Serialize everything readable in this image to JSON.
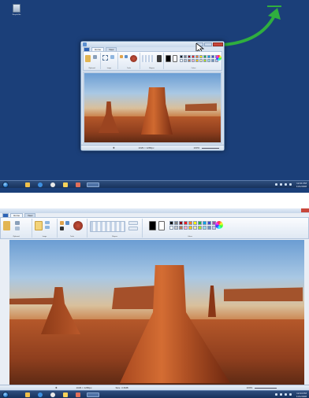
{
  "top_scene": {
    "desktop": {
      "recycle_bin_label": "Recycle Bin"
    },
    "paint_window": {
      "tabs": [
        "",
        "Home",
        "View"
      ],
      "ribbon_groups": [
        "Clipboard",
        "Image",
        "Tools",
        "Shapes",
        "Colors"
      ],
      "status": {
        "dimensions": "1029 × 1280px",
        "zoom": "100%"
      }
    },
    "taskbar": {
      "clock_time": "12:21 PM",
      "clock_date": "11/1/2008"
    }
  },
  "bottom_scene": {
    "paint_window": {
      "tabs": [
        "",
        "Home",
        "View"
      ],
      "ribbon_groups": [
        "Clipboard",
        "Image",
        "Tools",
        "Shapes",
        "Colors"
      ],
      "status": {
        "dimensions": "1029 × 1280px",
        "size": "Size: 3.3MB",
        "zoom": "100%"
      }
    },
    "taskbar": {
      "clock_time": "12:24 PM",
      "clock_date": "11/1/2008"
    }
  },
  "colors": {
    "desktop_blue": "#1b3f79",
    "arrow_green": "#2fae3f",
    "taskbar": "#17325c"
  },
  "palette": [
    "#000000",
    "#7f7f7f",
    "#880015",
    "#ed1c24",
    "#ff7f27",
    "#fff200",
    "#22b14c",
    "#00a2e8",
    "#3f48cc",
    "#a349a4",
    "#ffffff",
    "#c3c3c3",
    "#b97a57",
    "#ffaec9",
    "#ffc90e",
    "#efe4b0",
    "#b5e61d",
    "#99d9ea",
    "#7092be",
    "#c8bfe7"
  ]
}
